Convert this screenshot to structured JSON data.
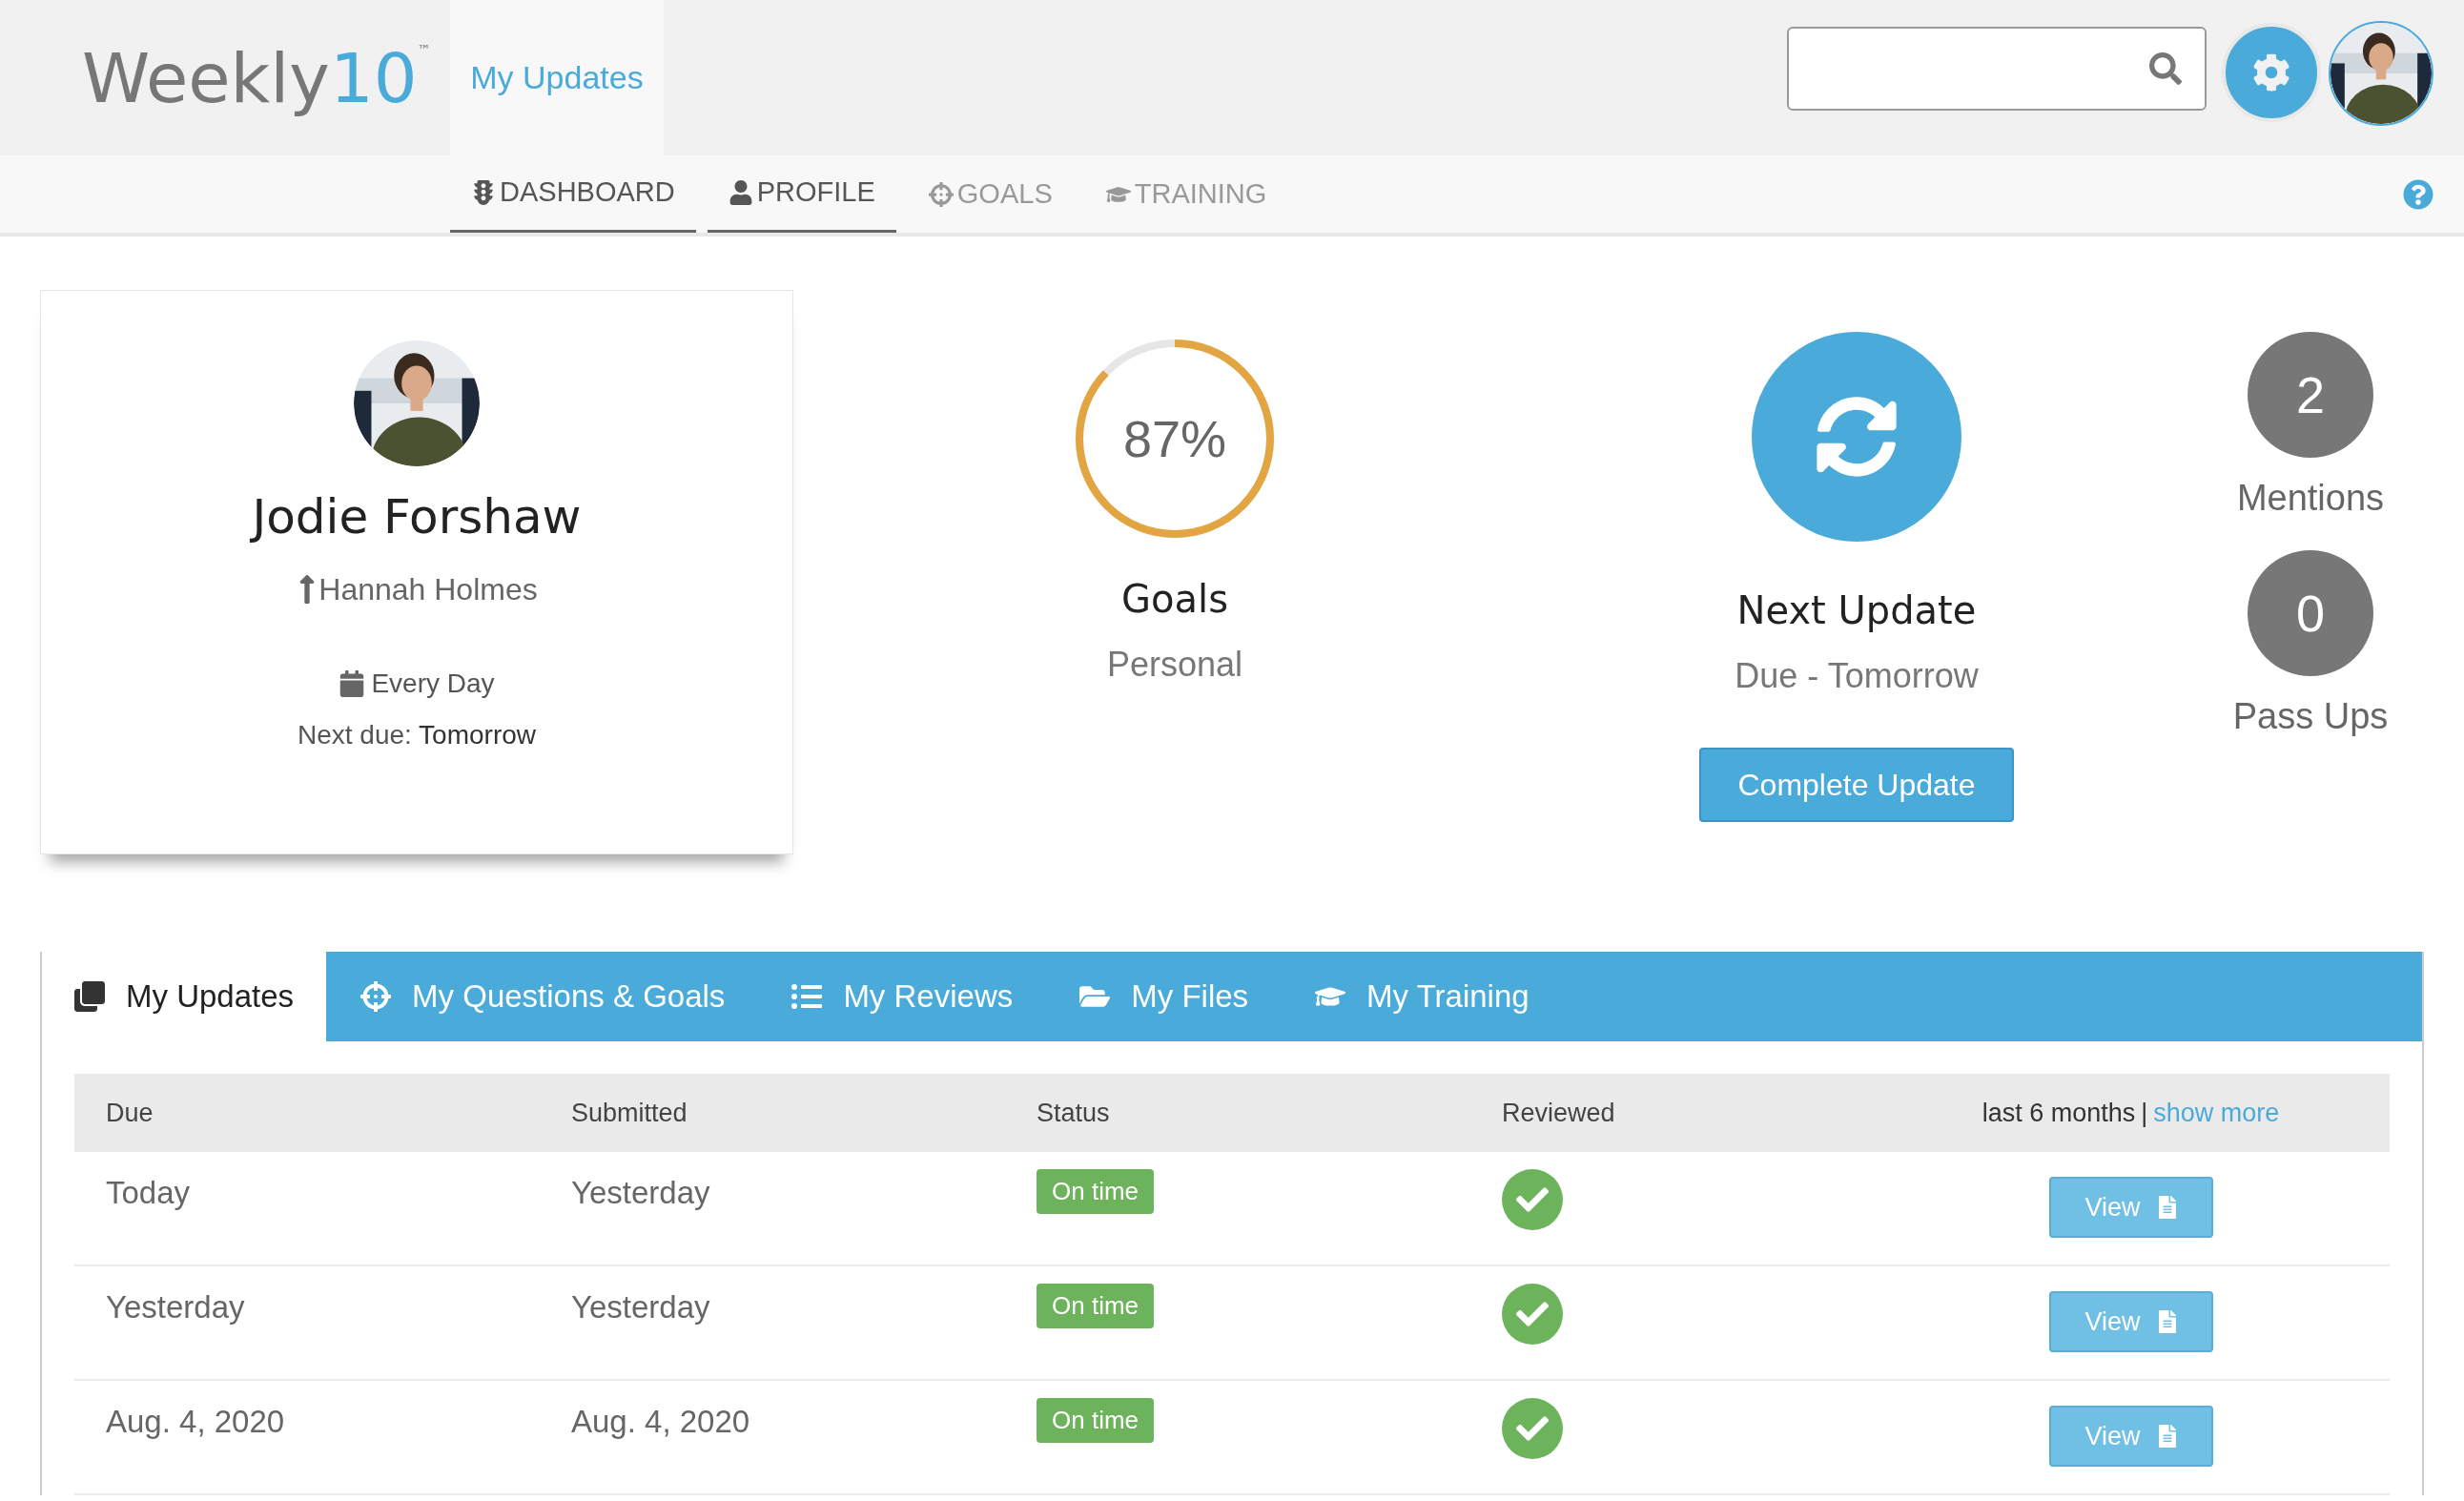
{
  "logo": {
    "word": "Weekly",
    "number": "10",
    "mark": "™"
  },
  "header_tab": {
    "label": "My Updates",
    "selected": true
  },
  "nav": [
    {
      "label": "DASHBOARD",
      "active": true
    },
    {
      "label": "PROFILE",
      "active": true
    },
    {
      "label": "GOALS",
      "active": false
    },
    {
      "label": "TRAINING",
      "active": false
    }
  ],
  "profile": {
    "name": "Jodie Forshaw",
    "manager": "Hannah Holmes",
    "frequency": "Every Day",
    "next_due_label": "Next due:",
    "next_due": "Tomorrow"
  },
  "goals": {
    "level": 0.87,
    "percent": "87%",
    "title": "Goals",
    "subtitle": "Personal"
  },
  "next_update": {
    "title": "Next Update",
    "subtitle": "Due - Tomorrow",
    "button": "Complete Update"
  },
  "counters": [
    {
      "count": "2",
      "label": "Mentions"
    },
    {
      "count": "0",
      "label": "Pass Ups"
    }
  ],
  "tabs": [
    {
      "label": "My Updates",
      "selected": true
    },
    {
      "label": "My Questions & Goals",
      "selected": false
    },
    {
      "label": "My Reviews",
      "selected": false
    },
    {
      "label": "My Files",
      "selected": false
    },
    {
      "label": "My Training",
      "selected": false
    }
  ],
  "table": {
    "columns": [
      "Due",
      "Submitted",
      "Status",
      "Reviewed"
    ],
    "range": "last 6 months",
    "separator": "|",
    "show_more": "show more",
    "rows": [
      {
        "due": "Today",
        "submitted": "Yesterday",
        "status": "On time",
        "reviewed": true,
        "action": "View"
      },
      {
        "due": "Yesterday",
        "submitted": "Yesterday",
        "status": "On time",
        "reviewed": true,
        "action": "View"
      },
      {
        "due": "Aug. 4, 2020",
        "submitted": "Aug. 4, 2020",
        "status": "On time",
        "reviewed": true,
        "action": "View"
      }
    ]
  }
}
